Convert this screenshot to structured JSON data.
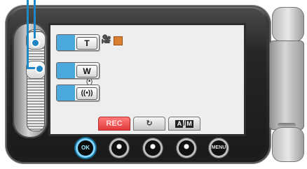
{
  "screen": {
    "zoom_tele_label": "T",
    "zoom_wide_label": "W",
    "stabilizer_label": "((•))",
    "stabilizer_sub": "(•)"
  },
  "icons": {
    "movie_mode": "🎥",
    "card_icon": "card-icon"
  },
  "tabs": {
    "rec": "REC",
    "loop": "↻",
    "a": "A",
    "m": "M"
  },
  "buttons": {
    "ok": "OK",
    "menu": "MENU"
  },
  "colors": {
    "accent_blue": "#1e88c7",
    "rec_red": "#e13b3b",
    "menu_blue": "#4aa8dd"
  }
}
